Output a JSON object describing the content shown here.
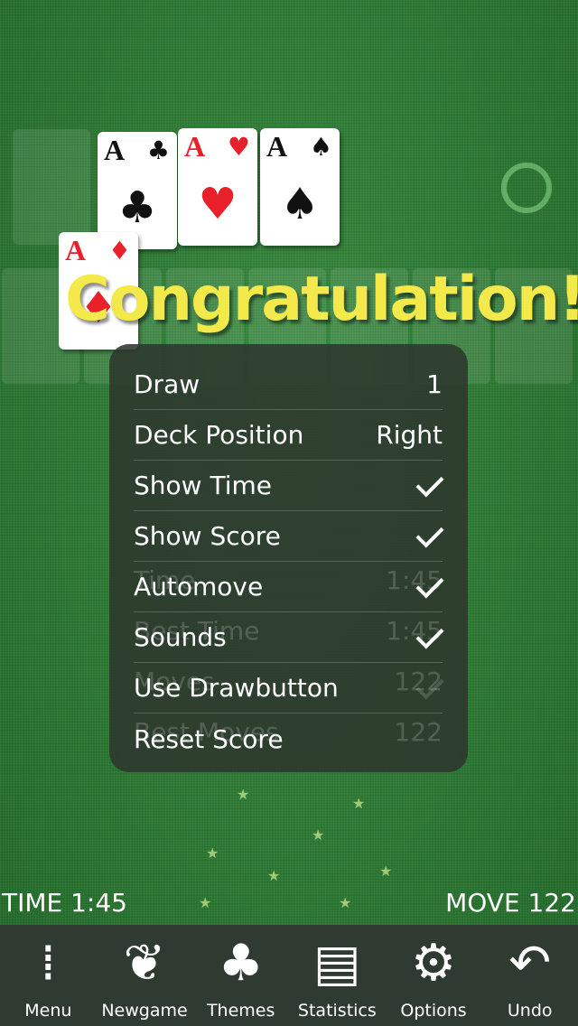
{
  "cards": [
    {
      "rank": "A",
      "suit": "♣",
      "color": "black"
    },
    {
      "rank": "A",
      "suit": "♥",
      "color": "red"
    },
    {
      "rank": "A",
      "suit": "♠",
      "color": "black"
    },
    {
      "rank": "A",
      "suit": "♦",
      "color": "red"
    }
  ],
  "congrats": "Congratulation!",
  "stats_ghost": [
    {
      "label": "Time",
      "value": "1:45"
    },
    {
      "label": "Best Time",
      "value": "1:45"
    },
    {
      "label": "Moves",
      "value": "122"
    },
    {
      "label": "Best Moves",
      "value": "122"
    }
  ],
  "options": [
    {
      "label": "Draw",
      "value": "1"
    },
    {
      "label": "Deck Position",
      "value": "Right"
    },
    {
      "label": "Show Time",
      "checked": true
    },
    {
      "label": "Show Score",
      "checked": true
    },
    {
      "label": "Automove",
      "checked": true
    },
    {
      "label": "Sounds",
      "checked": true
    },
    {
      "label": "Use Drawbutton",
      "checked": false
    },
    {
      "label": "Reset Score"
    }
  ],
  "status": {
    "time": "TIME 1:45",
    "moves": "MOVE 122"
  },
  "toolbar": [
    {
      "label": "Menu",
      "icon": "menu-dots-icon"
    },
    {
      "label": "Newgame",
      "icon": "leaf-icon"
    },
    {
      "label": "Themes",
      "icon": "clover-icon"
    },
    {
      "label": "Statistics",
      "icon": "document-icon"
    },
    {
      "label": "Options",
      "icon": "gears-icon"
    },
    {
      "label": "Undo",
      "icon": "undo-arrow-icon"
    }
  ],
  "colors": {
    "felt": "#2f7d37",
    "congrats": "#f3e94a",
    "suit_red": "#e8202a",
    "panel": "#2d372d"
  }
}
